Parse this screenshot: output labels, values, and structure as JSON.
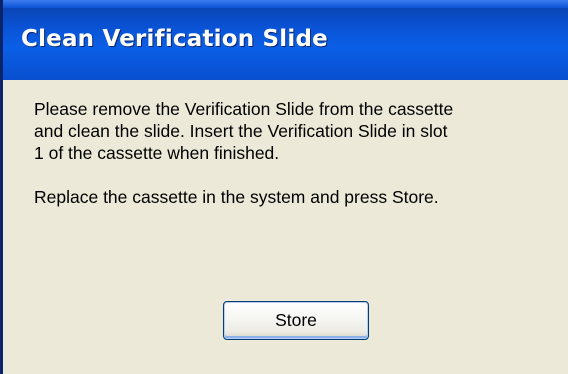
{
  "window": {
    "title": "Clean Verification Slide"
  },
  "message": {
    "line1": "Please remove the Verification Slide from the cassette",
    "line2": "and clean the slide.  Insert the Verification Slide in slot",
    "line3": "1 of the cassette when finished.",
    "line4": "Replace the cassette in the system and press Store."
  },
  "buttons": {
    "store_label": "Store"
  },
  "colors": {
    "titlebar": "#0b5fe6",
    "dialog_background": "#ece9d8",
    "button_border": "#003c74"
  }
}
